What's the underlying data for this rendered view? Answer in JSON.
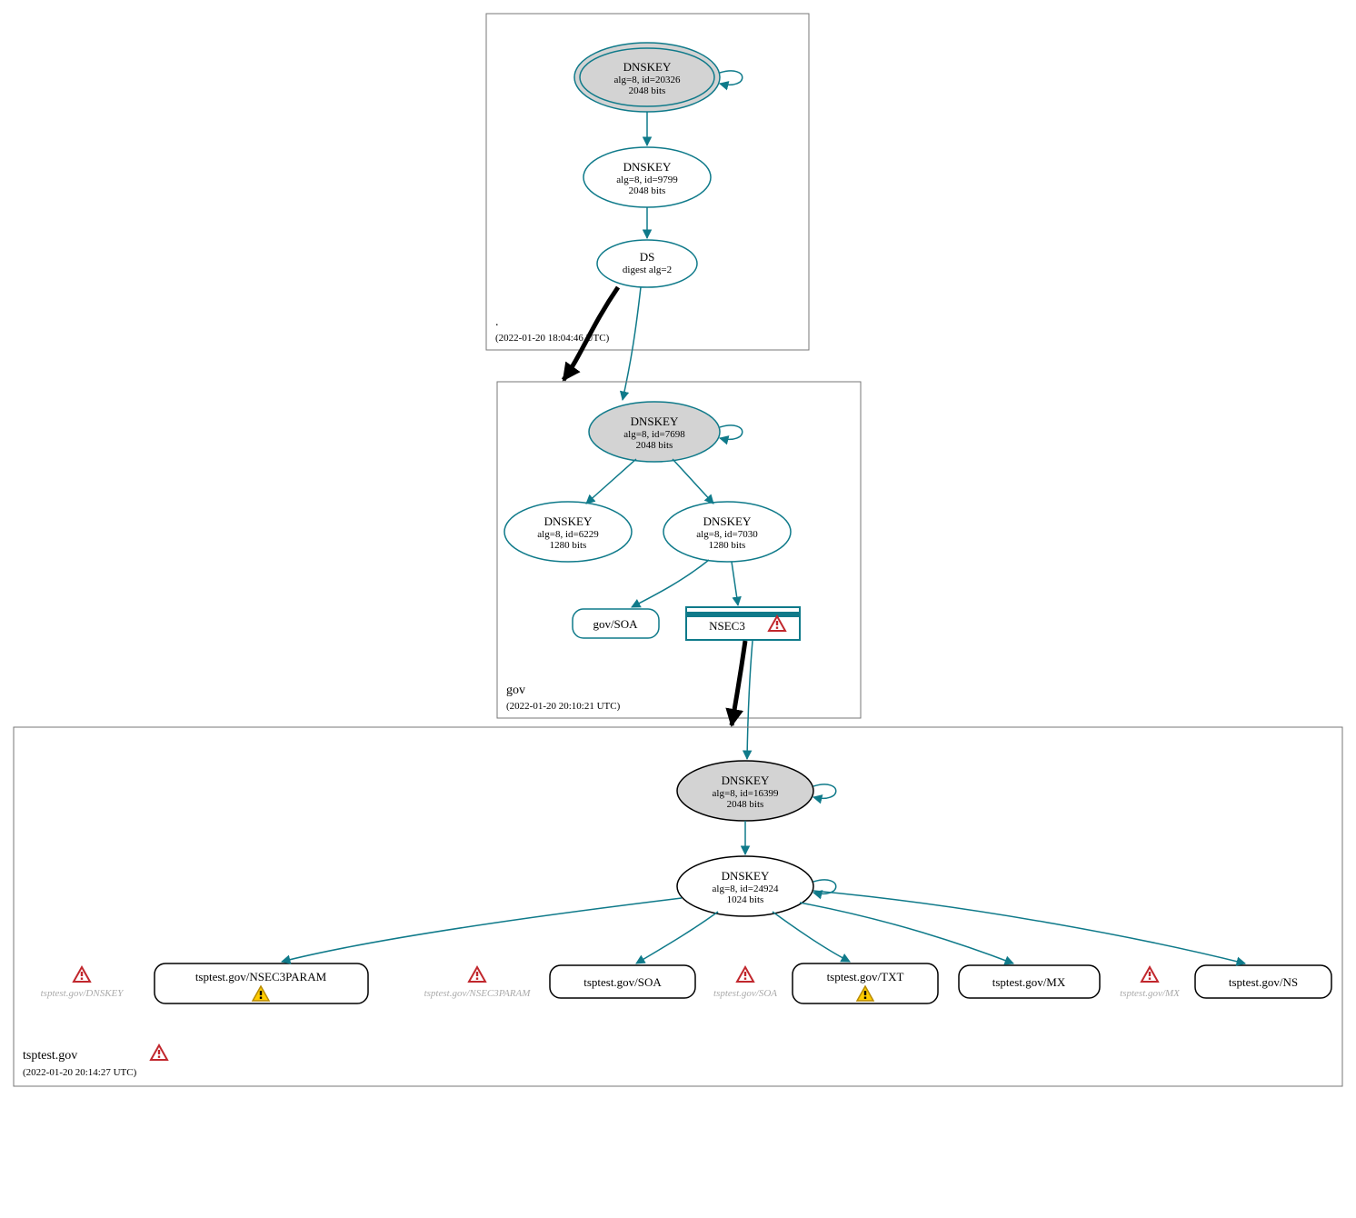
{
  "zones": {
    "root": {
      "name": ".",
      "timestamp": "(2022-01-20 18:04:46 UTC)"
    },
    "gov": {
      "name": "gov",
      "timestamp": "(2022-01-20 20:10:21 UTC)"
    },
    "tsp": {
      "name": "tsptest.gov",
      "timestamp": "(2022-01-20 20:14:27 UTC)"
    }
  },
  "nodes": {
    "root_ksk": {
      "title": "DNSKEY",
      "line1": "alg=8, id=20326",
      "line2": "2048 bits"
    },
    "root_zsk": {
      "title": "DNSKEY",
      "line1": "alg=8, id=9799",
      "line2": "2048 bits"
    },
    "root_ds": {
      "title": "DS",
      "line1": "digest alg=2"
    },
    "gov_ksk": {
      "title": "DNSKEY",
      "line1": "alg=8, id=7698",
      "line2": "2048 bits"
    },
    "gov_zsk_a": {
      "title": "DNSKEY",
      "line1": "alg=8, id=6229",
      "line2": "1280 bits"
    },
    "gov_zsk_b": {
      "title": "DNSKEY",
      "line1": "alg=8, id=7030",
      "line2": "1280 bits"
    },
    "gov_soa": {
      "label": "gov/SOA"
    },
    "gov_nsec3": {
      "label": "NSEC3"
    },
    "tsp_ksk": {
      "title": "DNSKEY",
      "line1": "alg=8, id=16399",
      "line2": "2048 bits"
    },
    "tsp_zsk": {
      "title": "DNSKEY",
      "line1": "alg=8, id=24924",
      "line2": "1024 bits"
    },
    "tsp_nsec3p": {
      "label": "tsptest.gov/NSEC3PARAM"
    },
    "tsp_soa": {
      "label": "tsptest.gov/SOA"
    },
    "tsp_txt": {
      "label": "tsptest.gov/TXT"
    },
    "tsp_mx": {
      "label": "tsptest.gov/MX"
    },
    "tsp_ns": {
      "label": "tsptest.gov/NS"
    }
  },
  "ghosts": {
    "dnskey": "tsptest.gov/DNSKEY",
    "nsec3param": "tsptest.gov/NSEC3PARAM",
    "soa": "tsptest.gov/SOA",
    "mx": "tsptest.gov/MX"
  }
}
